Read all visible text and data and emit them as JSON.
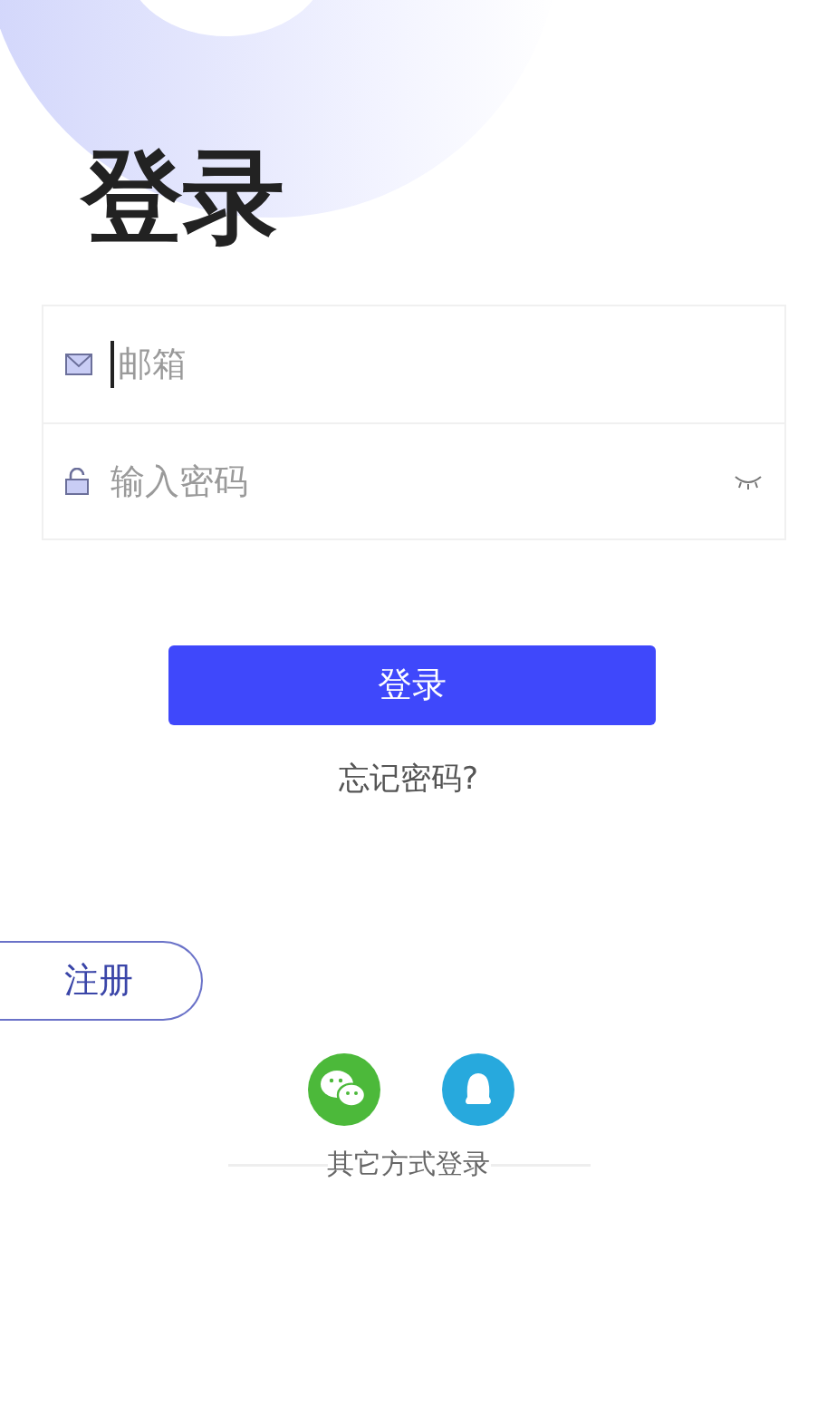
{
  "title": "登录",
  "fields": [
    {
      "kind": "email",
      "placeholder": "邮箱",
      "focused": true
    },
    {
      "kind": "password",
      "placeholder": "输入密码",
      "focused": false
    }
  ],
  "login_button": "登录",
  "forgot_link": "忘记密码?",
  "register_button": "注册",
  "social_logins": [
    {
      "kind": "wechat",
      "color": "#4cb93a"
    },
    {
      "kind": "qq",
      "color": "#27a9dd"
    }
  ],
  "other_login_label": "其它方式登录"
}
